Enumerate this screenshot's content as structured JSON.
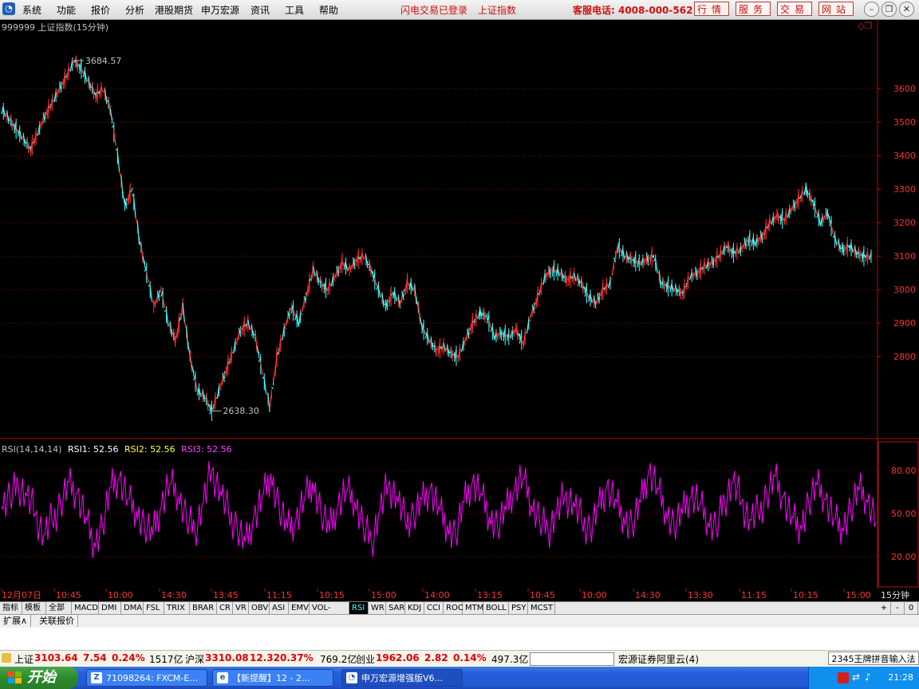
{
  "menu": {
    "items": [
      "系统",
      "功能",
      "报价",
      "分析",
      "港股期货",
      "申万宏源",
      "资讯",
      "工具",
      "帮助"
    ],
    "status_login": "闪电交易已登录",
    "status_index": "上证指数",
    "hotline": "客服电话: 4008-000-562",
    "quick_buttons": [
      "行情",
      "服务",
      "交易",
      "网站"
    ]
  },
  "chart_data": [
    {
      "type": "line",
      "title": "999999 上证指数(15分钟)",
      "ylabel": "",
      "ylim": [
        2560,
        3760
      ],
      "y_ticks": [
        2800,
        2900,
        3000,
        3100,
        3200,
        3300,
        3400,
        3500,
        3600
      ],
      "high_label": "3684.57",
      "low_label": "2638.30",
      "series": [
        {
          "values": [
            3540,
            3510,
            3480,
            3450,
            3420,
            3470,
            3520,
            3560,
            3600,
            3640,
            3684,
            3660,
            3620,
            3580,
            3600,
            3540,
            3400,
            3250,
            3300,
            3150,
            3050,
            2950,
            3000,
            2900,
            2850,
            2950,
            2800,
            2700,
            2680,
            2638,
            2700,
            2760,
            2820,
            2880,
            2900,
            2860,
            2750,
            2650,
            2800,
            2880,
            2950,
            2900,
            2980,
            3060,
            3020,
            3000,
            3040,
            3080,
            3060,
            3090,
            3100,
            3060,
            3000,
            2950,
            2990,
            2960,
            3020,
            3000,
            2890,
            2850,
            2820,
            2830,
            2810,
            2800,
            2850,
            2900,
            2930,
            2920,
            2860,
            2870,
            2860,
            2880,
            2840,
            2920,
            2980,
            3040,
            3060,
            3050,
            3030,
            3040,
            3020,
            2980,
            2960,
            3000,
            3020,
            3130,
            3100,
            3090,
            3080,
            3090,
            3100,
            3020,
            3010,
            3000,
            2990,
            3040,
            3050,
            3070,
            3080,
            3100,
            3130,
            3110,
            3120,
            3150,
            3140,
            3160,
            3200,
            3220,
            3210,
            3240,
            3270,
            3300,
            3260,
            3200,
            3230,
            3150,
            3120,
            3130,
            3110,
            3100,
            3100
          ]
        }
      ]
    },
    {
      "type": "line",
      "title": "RSI(14,14,14)",
      "rsi1_label": "RSI1: 52.56",
      "rsi2_label": "RSI2: 52.56",
      "rsi3_label": "RSI3: 52.56",
      "ylim": [
        0,
        100
      ],
      "y_ticks": [
        20.0,
        50.0,
        80.0
      ],
      "series": [
        {
          "name": "RSI3",
          "values": [
            55,
            60,
            70,
            62,
            50,
            35,
            45,
            58,
            72,
            65,
            48,
            30,
            42,
            68,
            75,
            60,
            52,
            40,
            35,
            55,
            70,
            62,
            45,
            38,
            58,
            80,
            66,
            50,
            42,
            30,
            48,
            62,
            78,
            55,
            40,
            45,
            60,
            72,
            50,
            38,
            55,
            65,
            58,
            40,
            30,
            52,
            70,
            62,
            45,
            50,
            60,
            68,
            55,
            42,
            35,
            58,
            72,
            64,
            48,
            40,
            52,
            66,
            74,
            56,
            44,
            38,
            50,
            62,
            58,
            45,
            40,
            55,
            70,
            60,
            48,
            42,
            58,
            80,
            68,
            52,
            40,
            50,
            62,
            56,
            44,
            38,
            60,
            72,
            58,
            46,
            50,
            64,
            76,
            62,
            48,
            42,
            58,
            70,
            60,
            46,
            40,
            52,
            66,
            58,
            44
          ]
        }
      ]
    }
  ],
  "time_labels": [
    "12月07日",
    "10:45",
    "10:00",
    "14:30",
    "13:45",
    "11:15",
    "10:15",
    "15:00",
    "14:00",
    "13:15",
    "10:45",
    "10:00",
    "14:30",
    "13:30",
    "11:15",
    "10:15",
    "15:00"
  ],
  "period_label": "15分钟",
  "indicator_tabs": [
    "指标",
    "模板",
    "全部",
    "MACD",
    "DMI",
    "DMA",
    "FSL",
    "TRIX",
    "BRAR",
    "CR",
    "VR",
    "OBV",
    "ASI",
    "EMV",
    "VOL-TDX",
    "RSI",
    "WR",
    "SAR",
    "KDJ",
    "CCI",
    "ROC",
    "MTM",
    "BOLL",
    "PSY",
    "MCST"
  ],
  "active_tab": "RSI",
  "nav_buttons": [
    "+",
    "-",
    "0"
  ],
  "ext_tabs": [
    "扩展∧",
    "关联报价"
  ],
  "quote": {
    "sh_label": "上证",
    "sh_value": "3103.64",
    "sh_change": "7.54",
    "sh_pct": "0.24%",
    "sh_amount": "1517亿",
    "hs_label": "沪深",
    "hs_value": "3310.08",
    "hs_change": "12.32",
    "hs_pct": "0.37%",
    "hs_amount": "769.2亿",
    "cy_label": "创业",
    "cy_value": "1962.06",
    "cy_change": "2.82",
    "cy_pct": "0.14%",
    "cy_amount": "497.3亿",
    "broker": "宏源证券阿里云(4)"
  },
  "ime": "2345王牌拼音输入法",
  "taskbar": {
    "start": "开始",
    "buttons": [
      "71098264: FXCM-E...",
      "【新提醒】12 - 2...",
      "申万宏源增强版V6..."
    ],
    "clock": "21:28"
  },
  "colors": {
    "up": "#ff3030",
    "down": "#40ffff",
    "rsi": "#ff00ff",
    "axis": "#b01010",
    "grid": "#8b0000",
    "bg": "#000000"
  }
}
